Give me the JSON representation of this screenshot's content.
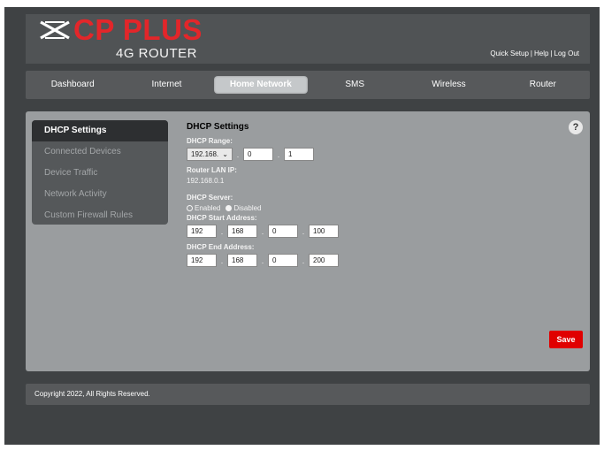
{
  "header": {
    "brand": "CP PLUS",
    "subbrand": "4G ROUTER",
    "links": [
      "Quick Setup",
      "Help",
      "Log Out"
    ],
    "link_separator": "|"
  },
  "nav": {
    "tabs": [
      {
        "label": "Dashboard",
        "active": false
      },
      {
        "label": "Internet",
        "active": false
      },
      {
        "label": "Home Network",
        "active": true
      },
      {
        "label": "SMS",
        "active": false
      },
      {
        "label": "Wireless",
        "active": false
      },
      {
        "label": "Router",
        "active": false
      }
    ]
  },
  "sidebar": {
    "items": [
      {
        "label": "DHCP Settings",
        "active": true
      },
      {
        "label": "Connected Devices",
        "active": false
      },
      {
        "label": "Device Traffic",
        "active": false
      },
      {
        "label": "Network Activity",
        "active": false
      },
      {
        "label": "Custom Firewall Rules",
        "active": false
      }
    ]
  },
  "form": {
    "title": "DHCP Settings",
    "help_label": "?",
    "dhcp_range": {
      "label": "DHCP Range:",
      "prefix_selected": "192.168.",
      "octet3": "0",
      "octet4": "1"
    },
    "router_lan_ip": {
      "label": "Router LAN IP:",
      "value": "192.168.0.1"
    },
    "dhcp_server": {
      "label": "DHCP Server:",
      "options": [
        "Enabled",
        "Disabled"
      ],
      "selected": "Disabled"
    },
    "start_address": {
      "label": "DHCP Start Address:",
      "octets": [
        "192",
        "168",
        "0",
        "100"
      ]
    },
    "end_address": {
      "label": "DHCP End Address:",
      "octets": [
        "192",
        "168",
        "0",
        "200"
      ]
    },
    "dot": "."
  },
  "save_label": "Save",
  "footer": {
    "copyright": "Copyright 2022, All Rights Reserved."
  },
  "colors": {
    "brand_red": "#e3262a",
    "save_red": "#e00000",
    "panel_bg": "#9a9d9f",
    "frame_bg": "#3f4244"
  }
}
